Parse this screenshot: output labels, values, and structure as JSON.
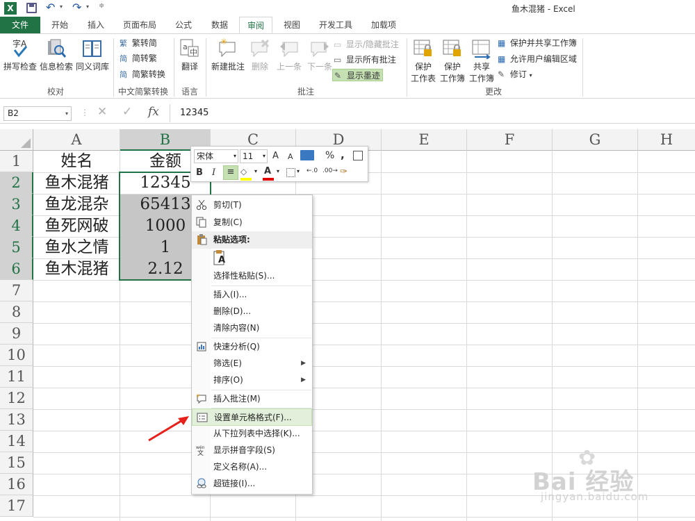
{
  "window": {
    "title": "鱼木混猪 - Excel"
  },
  "quick_access": {
    "app_icon": "excel-icon",
    "save_icon": "save-icon",
    "undo_icon": "undo-icon",
    "redo_icon": "redo-icon",
    "customize_icon": "customize-qat-icon"
  },
  "tabs": [
    "文件",
    "开始",
    "插入",
    "页面布局",
    "公式",
    "数据",
    "审阅",
    "视图",
    "开发工具",
    "加载项"
  ],
  "active_tab": "审阅",
  "ribbon": {
    "proofing": {
      "spell": "拼写检查",
      "research": "信息检索",
      "thesaurus": "同义词库",
      "group": "校对"
    },
    "chinese": {
      "trad": "繁转简",
      "simp": "简转繁",
      "convert": "简繁转换",
      "group": "中文简繁转换"
    },
    "language": {
      "translate": "翻译",
      "group": "语言"
    },
    "comments": {
      "new": "新建批注",
      "delete": "删除",
      "prev": "上一条",
      "next": "下一条",
      "showhide": "显示/隐藏批注",
      "showall": "显示所有批注",
      "ink": "显示墨迹",
      "group": "批注"
    },
    "changes": {
      "protect_sheet_1": "保护",
      "protect_sheet_2": "工作表",
      "protect_book_1": "保护",
      "protect_book_2": "工作簿",
      "share_1": "共享",
      "share_2": "工作簿",
      "protect_share": "保护并共享工作簿",
      "allow_edit": "允许用户编辑区域",
      "track": "修订",
      "group": "更改"
    }
  },
  "formula_bar": {
    "name_box": "B2",
    "fx": "fx",
    "value": "12345"
  },
  "columns": [
    "A",
    "B",
    "C",
    "D",
    "E",
    "F",
    "G",
    "H"
  ],
  "rows": [
    "1",
    "2",
    "3",
    "4",
    "5",
    "6",
    "7",
    "8",
    "9",
    "10",
    "11",
    "12",
    "13",
    "14",
    "15",
    "16",
    "17"
  ],
  "cells": {
    "header": [
      "姓名",
      "金额"
    ],
    "data": [
      [
        "鱼木混猪",
        "12345"
      ],
      [
        "鱼龙混杂",
        "65413"
      ],
      [
        "鱼死网破",
        "1000"
      ],
      [
        "鱼水之情",
        "1"
      ],
      [
        "鱼木混猪",
        "2.12"
      ]
    ]
  },
  "mini_toolbar": {
    "font": "宋体",
    "size": "11",
    "grow": "A",
    "shrink": "A",
    "percent": "%",
    "comma": ",",
    "bold": "B",
    "italic": "I",
    "font_color": "A"
  },
  "context_menu": [
    {
      "label": "剪切(T)",
      "icon": "scissors-icon"
    },
    {
      "label": "复制(C)",
      "icon": "copy-icon"
    },
    {
      "label": "粘贴选项:",
      "icon": "paste-icon"
    },
    {
      "label": "选择性粘贴(S)...",
      "icon": ""
    },
    {
      "label": "插入(I)...",
      "icon": ""
    },
    {
      "label": "删除(D)...",
      "icon": ""
    },
    {
      "label": "清除内容(N)",
      "icon": ""
    },
    {
      "label": "快速分析(Q)",
      "icon": "quick-analysis-icon"
    },
    {
      "label": "筛选(E)",
      "icon": ""
    },
    {
      "label": "排序(O)",
      "icon": ""
    },
    {
      "label": "插入批注(M)",
      "icon": "insert-comment-icon"
    },
    {
      "label": "设置单元格格式(F)...",
      "icon": "format-cells-icon"
    },
    {
      "label": "从下拉列表中选择(K)...",
      "icon": ""
    },
    {
      "label": "显示拼音字段(S)",
      "icon": "phonetic-icon"
    },
    {
      "label": "定义名称(A)...",
      "icon": ""
    },
    {
      "label": "超链接(I)...",
      "icon": "hyperlink-icon"
    }
  ],
  "paste_option_letter": "A",
  "watermark": {
    "brand": "Bai 经验",
    "url": "jingyan.baidu.com"
  },
  "colors": {
    "excel_green": "#217346",
    "selection_gray": "#c6c6c6",
    "highlight": "#e2efda"
  }
}
